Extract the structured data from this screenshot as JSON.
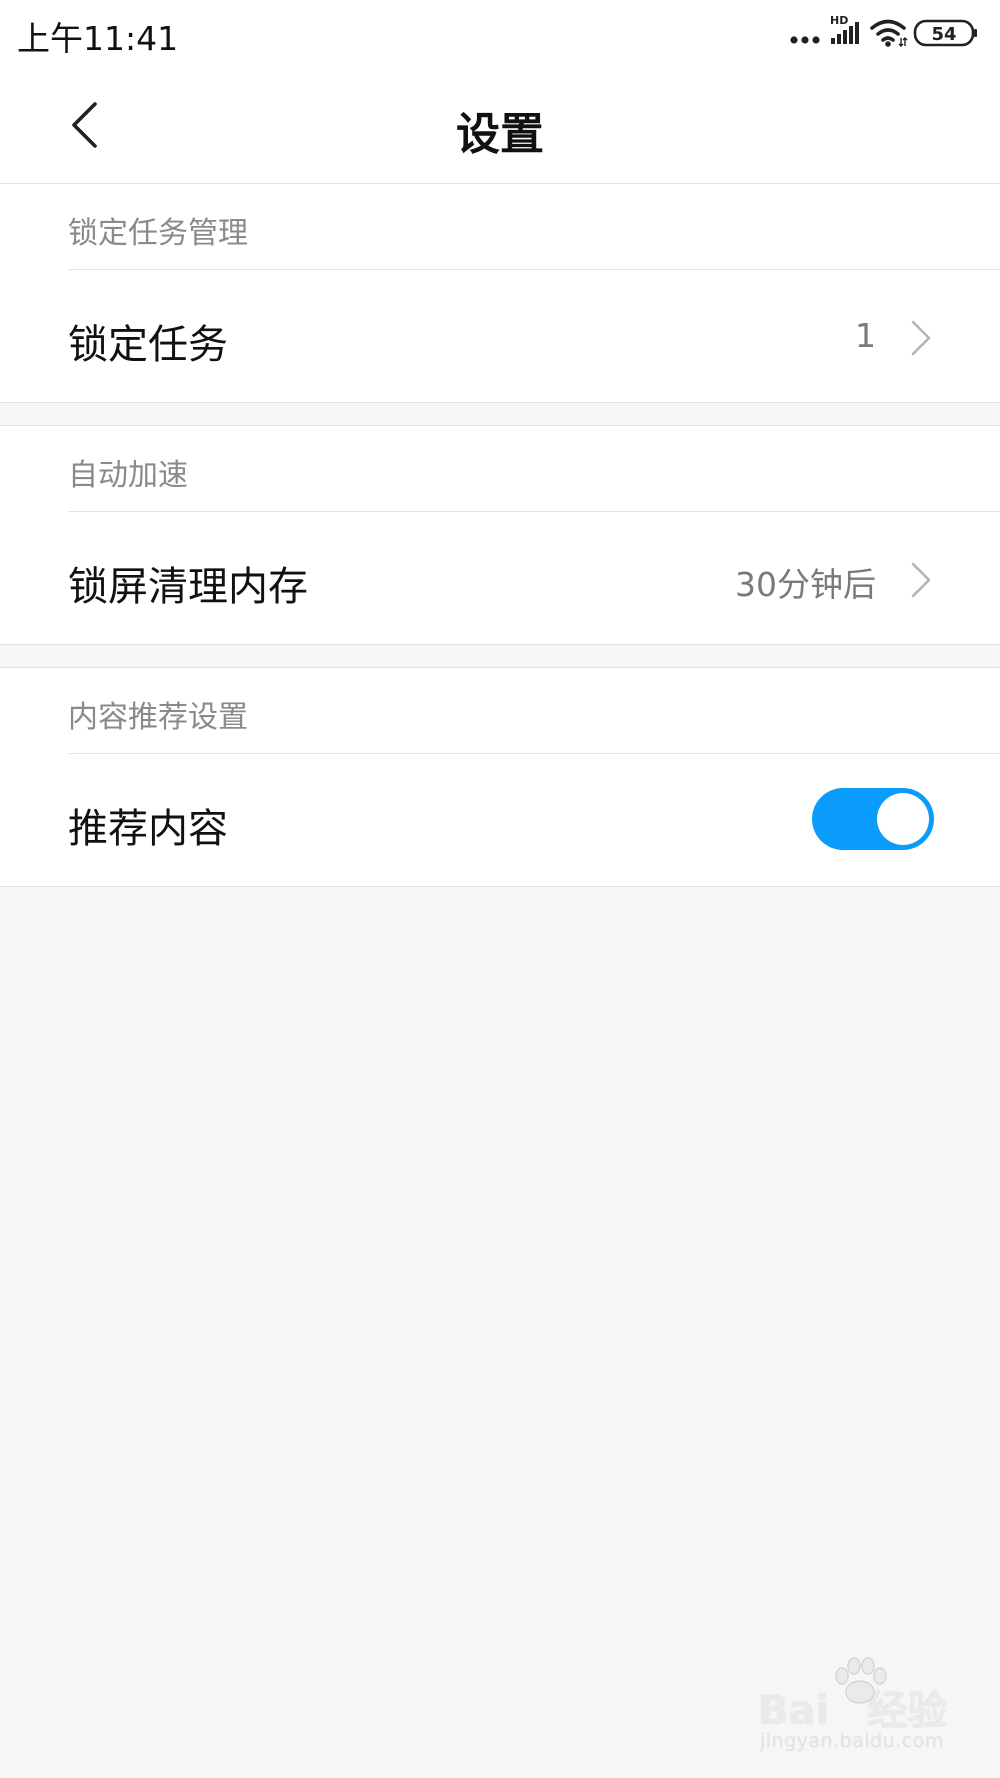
{
  "status_bar": {
    "time": "上午11:41",
    "network_badge": "HD",
    "battery_level": "54"
  },
  "header": {
    "title": "设置"
  },
  "sections": [
    {
      "header": "锁定任务管理",
      "row": {
        "label": "锁定任务",
        "value": "1"
      }
    },
    {
      "header": "自动加速",
      "row": {
        "label": "锁屏清理内存",
        "value": "30分钟后"
      }
    },
    {
      "header": "内容推荐设置",
      "row": {
        "label": "推荐内容",
        "toggle_on": true
      }
    }
  ],
  "watermark": {
    "brand": "Bai",
    "brand_suffix": "经验",
    "url": "jingyan.baidu.com"
  },
  "colors": {
    "accent": "#0a9cfb",
    "background": "#f6f6f6",
    "surface": "#ffffff",
    "secondary_text": "#8a8a8a"
  }
}
